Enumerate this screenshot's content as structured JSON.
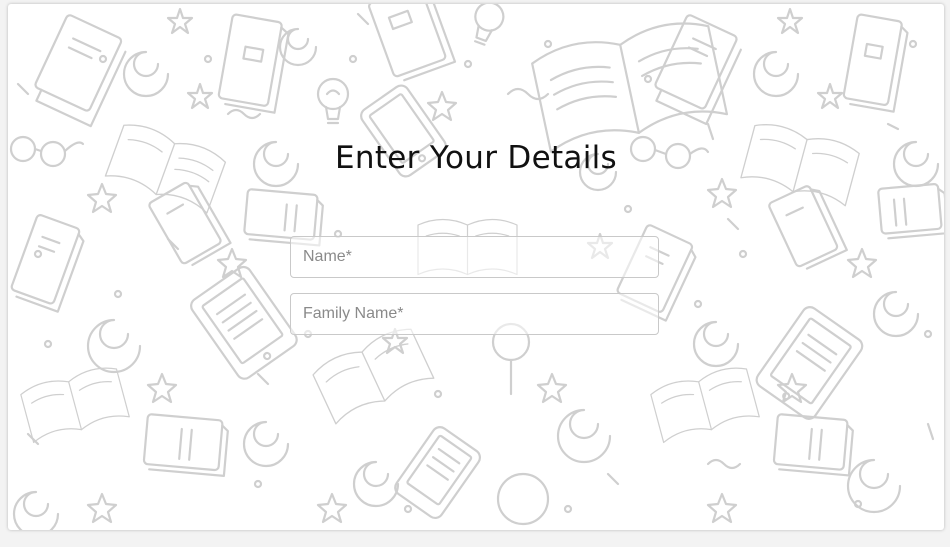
{
  "form": {
    "title": "Enter Your Details",
    "fields": [
      {
        "placeholder": "Name*",
        "value": ""
      },
      {
        "placeholder": "Family Name*",
        "value": ""
      }
    ]
  },
  "background": {
    "pattern": "doodle-books-stars-bulbs",
    "stroke_color": "#cfcfcf"
  }
}
